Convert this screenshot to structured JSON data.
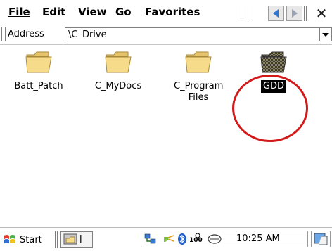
{
  "menu": {
    "file": "File",
    "edit": "Edit",
    "view": "View",
    "go": "Go",
    "favorites": "Favorites"
  },
  "address": {
    "label": "Address",
    "value": "\\C_Drive"
  },
  "files": [
    {
      "label": "Batt_Patch"
    },
    {
      "label": "C_MyDocs"
    },
    {
      "label": "C_Program Files"
    },
    {
      "label": "GDD",
      "selected": true
    }
  ],
  "taskbar": {
    "start_label": "Start",
    "clock": "10:25 AM"
  },
  "colors": {
    "folder": "#f6dc8a",
    "folder_selected": "#6c6650",
    "highlight": "#d21a1a",
    "nav_arrow": "#2f74d0"
  }
}
